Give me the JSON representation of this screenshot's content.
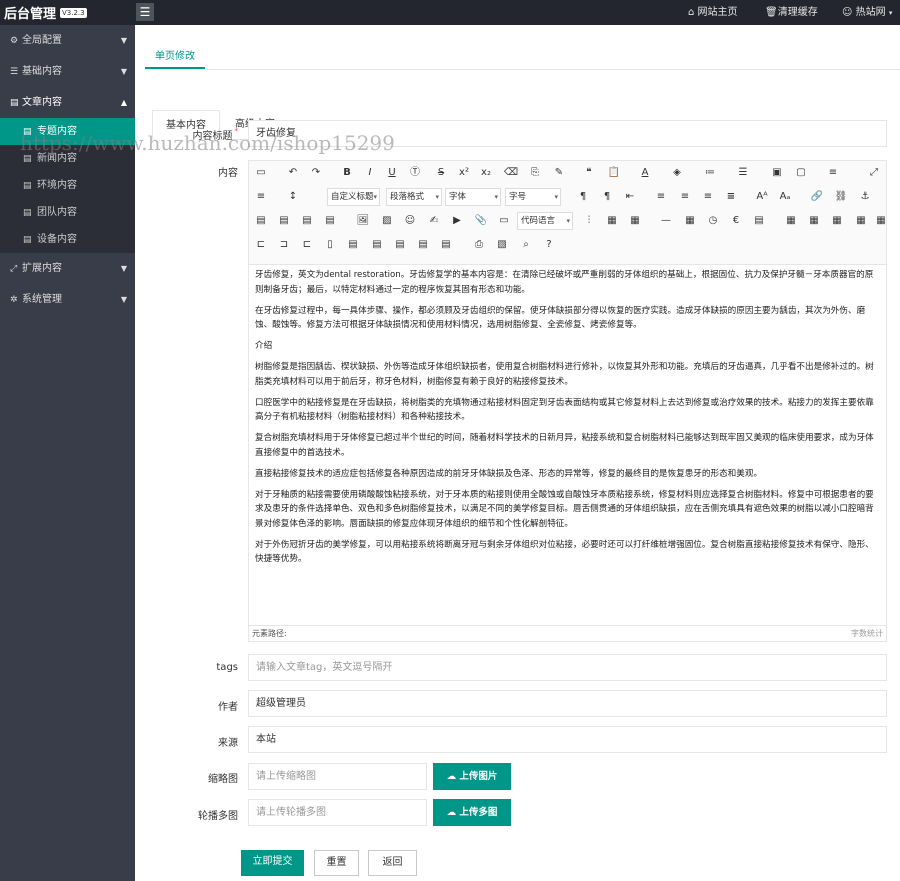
{
  "brand": {
    "title": "后台管理",
    "version": "V3.2.3"
  },
  "icons": {
    "menu": "hamburger-icon",
    "home": "home-icon",
    "trash": "trash-icon",
    "user": "user-icon"
  },
  "topnav": {
    "home": "网站主页",
    "cache": "清理缓存",
    "user": "热站网"
  },
  "sidebar": {
    "menus": [
      {
        "icon": "settings-icon",
        "label": "全局配置"
      },
      {
        "icon": "sliders-icon",
        "label": "基础内容"
      },
      {
        "icon": "file-icon",
        "label": "文章内容"
      },
      {
        "icon": "expand-icon",
        "label": "扩展内容"
      },
      {
        "icon": "gear-icon",
        "label": "系统管理"
      }
    ],
    "subitems": [
      {
        "label": "专题内容"
      },
      {
        "label": "新闻内容"
      },
      {
        "label": "环境内容"
      },
      {
        "label": "团队内容"
      },
      {
        "label": "设备内容"
      }
    ]
  },
  "page_tab": "单页修改",
  "subtabs": [
    "基本内容",
    "高级内容"
  ],
  "watermark": "https://www.huzhan.com/ishop15299",
  "form": {
    "title_label": "内容标题",
    "title_required": "*",
    "title_value": "牙齿修复",
    "content_label": "内容",
    "tags_label": "tags",
    "tags_placeholder": "请输入文章tag，英文逗号隔开",
    "author_label": "作者",
    "author_value": "超级管理员",
    "source_label": "来源",
    "source_value": "本站",
    "thumb_label": "缩略图",
    "thumb_placeholder": "请上传缩略图",
    "thumb_button": "上传图片",
    "gallery_label": "轮播多图",
    "gallery_placeholder": "请上传轮播多图",
    "gallery_button": "上传多图"
  },
  "editor": {
    "dropdowns": {
      "title": "自定义标题",
      "paragraph": "段落格式",
      "font": "字体",
      "size": "字号",
      "code": "代码语言"
    },
    "paragraphs": [
      "牙齿修复，英文为dental restoration。牙齿修复学的基本内容是：在清除已经破坏或严重削弱的牙体组织的基础上，根据固位、抗力及保护牙髓－牙本质器官的原则制备牙齿；最后，以特定材料通过一定的程序恢复其固有形态和功能。",
      "在牙齿修复过程中，每一具体步骤、操作，都必须顾及牙齿组织的保留。使牙体缺损部分得以恢复的医疗实践。造成牙体缺损的原因主要为龋齿，其次为外伤、磨蚀、酸蚀等。修复方法可根据牙体缺损情况和使用材料情况，选用树脂修复、全瓷修复、烤瓷修复等。",
      "介绍",
      "树脂修复是指因龋齿、楔状缺损、外伤等造成牙体组织缺损者，使用复合树脂材料进行修补，以恢复其外形和功能。充填后的牙齿逼真，几乎看不出是修补过的。树脂类充填材料可以用于前后牙，称牙色材料，树脂修复有赖于良好的粘接修复技术。",
      "口腔医学中的粘接修复是在牙齿缺损，将树脂类的充填物通过粘接材料固定到牙齿表面结构或其它修复材料上去达到修复或治疗效果的技术。粘接力的发挥主要依靠高分子有机粘接材料（树脂粘接材料）和各种粘接技术。",
      "复合树脂充填材料用于牙体修复已超过半个世纪的时间，随着材料学技术的日新月异，粘接系统和复合树脂材料已能够达到既牢固又美观的临床使用要求，成为牙体直接修复中的首选技术。",
      "直接粘接修复技术的适应症包括修复各种原因造成的前牙牙体缺损及色泽、形态的异常等，修复的最终目的是恢复患牙的形态和美观。",
      "对于牙釉质的粘接需要使用磷酸酸蚀粘接系统，对于牙本质的粘接则使用全酸蚀或自酸蚀牙本质粘接系统，修复材料则应选择复合树脂材料。修复中可根据患者的要求及患牙的条件选择单色、双色和多色树脂修复技术，以满足不同的美学修复目标。唇舌侧贯通的牙体组织缺损，应在舌侧充填具有遮色效果的树脂以减小口腔暗背景对修复体色泽的影响。唇面缺损的修复应体现牙体组织的细节和个性化解剖特征。",
      "对于外伤冠折牙齿的美学修复，可以用粘接系统将断离牙冠与剩余牙体组织对位粘接，必要时还可以打纤维桩增强固位。复合树脂直接粘接修复技术有保守、隐形、快捷等优势。"
    ],
    "path_label": "元素路径:",
    "word_count": "字数统计"
  },
  "buttons": {
    "submit": "立即提交",
    "reset": "重置",
    "back": "返回"
  }
}
